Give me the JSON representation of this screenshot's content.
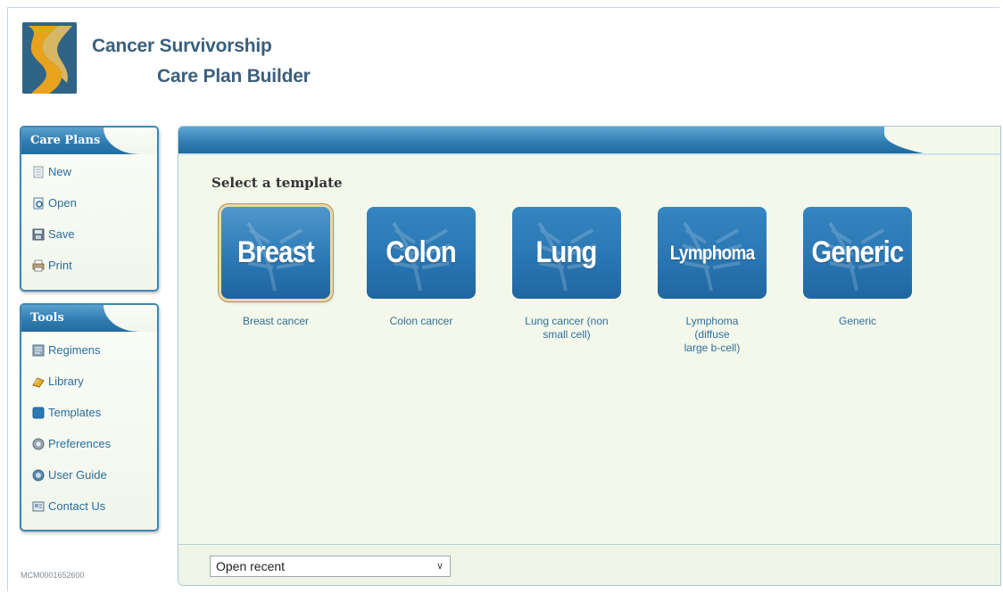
{
  "app": {
    "title_line1": "Cancer Survivorship",
    "title_line2": "Care Plan Builder",
    "logo_icon": "ribbon-path-logo",
    "build_id": "MCM0001652600"
  },
  "sidebar": {
    "care_plans": {
      "title": "Care Plans",
      "items": [
        {
          "label": "New",
          "icon": "new-document-icon"
        },
        {
          "label": "Open",
          "icon": "open-document-icon"
        },
        {
          "label": "Save",
          "icon": "save-icon"
        },
        {
          "label": "Print",
          "icon": "print-icon"
        }
      ]
    },
    "tools": {
      "title": "Tools",
      "items": [
        {
          "label": "Regimens",
          "icon": "regimens-icon"
        },
        {
          "label": "Library",
          "icon": "library-icon"
        },
        {
          "label": "Templates",
          "icon": "templates-icon"
        },
        {
          "label": "Preferences",
          "icon": "preferences-icon"
        },
        {
          "label": "User Guide",
          "icon": "user-guide-icon"
        },
        {
          "label": "Contact Us",
          "icon": "contact-us-icon"
        }
      ]
    }
  },
  "main": {
    "section_title": "Select a template",
    "templates": [
      {
        "tile_text": "Breast",
        "caption": "Breast cancer",
        "selected": true
      },
      {
        "tile_text": "Colon",
        "caption": "Colon cancer",
        "selected": false
      },
      {
        "tile_text": "Lung",
        "caption": "Lung cancer (non small cell)",
        "selected": false
      },
      {
        "tile_text": "Lymphoma",
        "caption": "Lymphoma (diffuse large b-cell)",
        "selected": false
      },
      {
        "tile_text": "Generic",
        "caption": "Generic",
        "selected": false
      }
    ],
    "open_recent": {
      "value": "Open recent"
    }
  },
  "colors": {
    "accent": "#2f7cb0",
    "title_text": "#3b5f7d",
    "link_text": "#2b6d9c",
    "panel_bg": "#f3f8eb"
  }
}
